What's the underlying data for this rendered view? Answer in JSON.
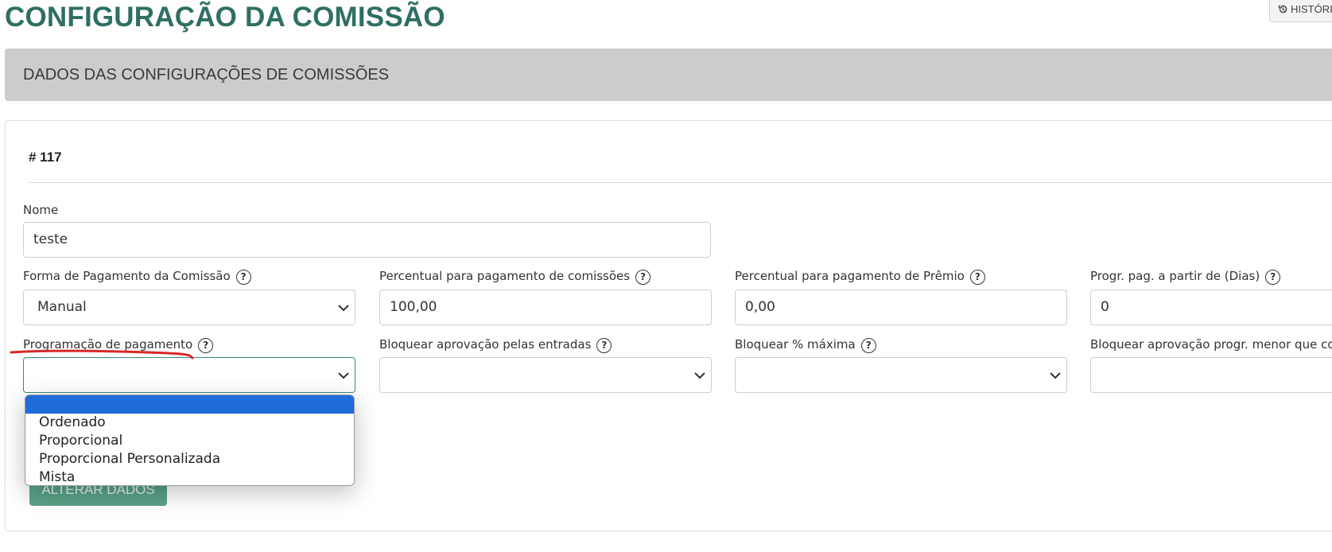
{
  "page": {
    "title": "CONFIGURAÇÃO DA COMISSÃO",
    "history_label": "HISTÓRICO"
  },
  "section": {
    "header": "DADOS DAS CONFIGURAÇÕES DE COMISSÕES"
  },
  "record": {
    "id_label": "# 117"
  },
  "form": {
    "nome": {
      "label": "Nome",
      "value": "teste"
    },
    "forma_pagamento": {
      "label": "Forma de Pagamento da Comissão",
      "value": "Manual"
    },
    "percentual_comissoes": {
      "label": "Percentual para pagamento de comissões",
      "value": "100,00"
    },
    "percentual_premio": {
      "label": "Percentual para pagamento de Prêmio",
      "value": "0,00"
    },
    "progr_dias": {
      "label": "Progr. pag. a partir de (Dias)",
      "value": "0"
    },
    "programacao_pagamento": {
      "label": "Programação de pagamento",
      "value": "",
      "options": [
        "",
        "Ordenado",
        "Proporcional",
        "Proporcional Personalizada",
        "Mista"
      ]
    },
    "bloquear_entradas": {
      "label": "Bloquear aprovação pelas entradas",
      "value": ""
    },
    "bloquear_maxima": {
      "label": "Bloquear % máxima",
      "value": ""
    },
    "bloquear_progr": {
      "label": "Bloquear aprovação progr. menor que comissão",
      "value": ""
    }
  },
  "actions": {
    "submit_label": "ALTERAR DADOS"
  },
  "colors": {
    "title": "#2f6f63",
    "header_bg": "#cccccc",
    "dropdown_highlight": "#1f6bd9",
    "submit_bg": "#5aa388",
    "annotation": "#d62828"
  },
  "icons": [
    "history-icon",
    "help-icon",
    "chevron-down-icon"
  ]
}
